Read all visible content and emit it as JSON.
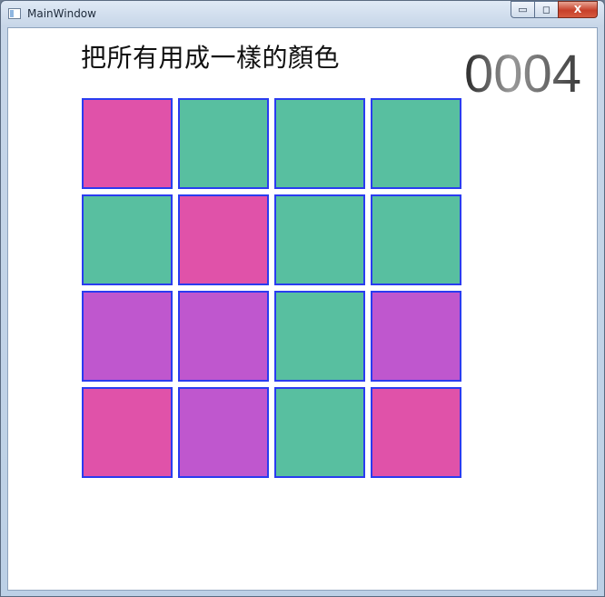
{
  "window": {
    "title": "MainWindow",
    "buttons": {
      "minimize": "▭",
      "maximize": "◻",
      "close": "X"
    }
  },
  "game": {
    "instruction": "把所有用成一樣的顏色",
    "counter": "0004",
    "colors": {
      "pink": "#e052a9",
      "green": "#58bfa0",
      "purple": "#bf57ce",
      "border": "#2a3cf0"
    },
    "grid": [
      [
        "pink",
        "green",
        "green",
        "green"
      ],
      [
        "green",
        "pink",
        "green",
        "green"
      ],
      [
        "purple",
        "purple",
        "green",
        "purple"
      ],
      [
        "pink",
        "purple",
        "green",
        "pink"
      ]
    ]
  }
}
